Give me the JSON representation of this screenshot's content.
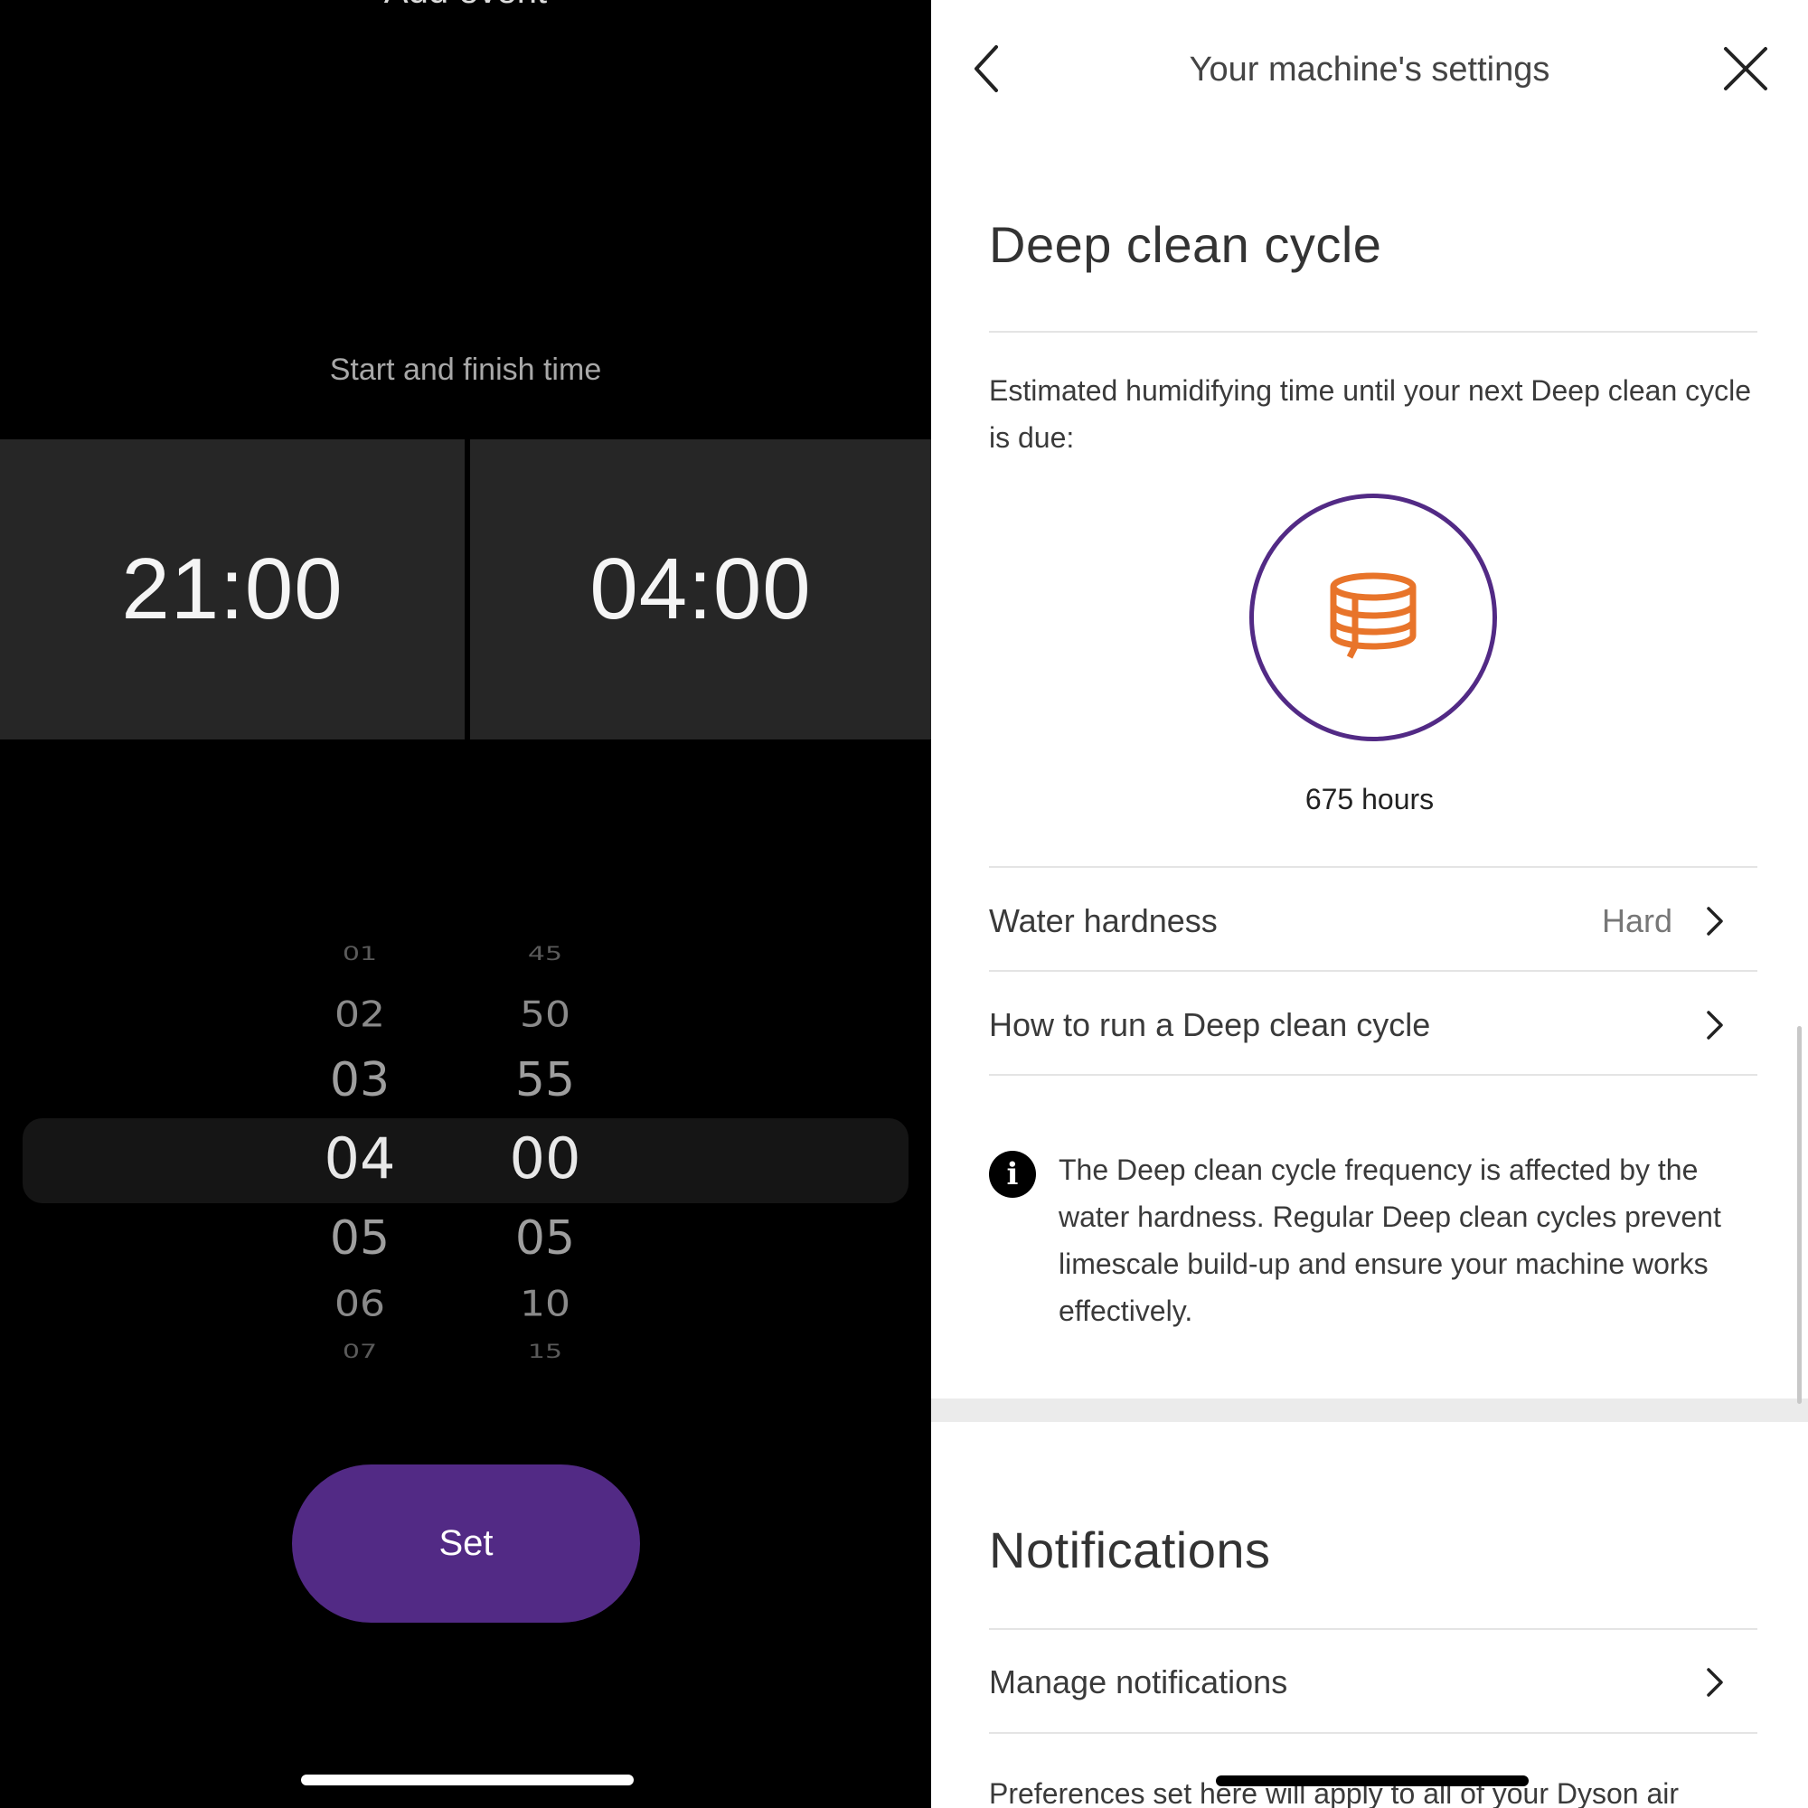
{
  "left_panel": {
    "header_title": "Add event",
    "subtitle": "Start and finish time",
    "start_time": "21:00",
    "finish_time": "04:00",
    "picker": {
      "hours": [
        "01",
        "02",
        "03",
        "04",
        "05",
        "06",
        "07"
      ],
      "minutes": [
        "45",
        "50",
        "55",
        "00",
        "05",
        "10",
        "15"
      ],
      "selected_hour": "04",
      "selected_minute": "00"
    },
    "set_button": "Set",
    "accent_color": "#522a85"
  },
  "right_panel": {
    "header_title": "Your machine's settings",
    "deep_clean": {
      "title": "Deep clean cycle",
      "estimate_text": "Estimated humidifying time until your next Deep clean cycle is due:",
      "hours": "675 hours",
      "icon": "filter-cartridge-icon",
      "icon_color": "#e8742a",
      "ring_color": "#522a85"
    },
    "rows": {
      "water_hardness_label": "Water hardness",
      "water_hardness_value": "Hard",
      "how_to_label": "How to run a Deep clean cycle"
    },
    "info_text": "The Deep clean cycle frequency is affected by the water hardness. Regular Deep clean cycles prevent limescale build-up and ensure your machine works effectively.",
    "notifications": {
      "title": "Notifications",
      "manage_label": "Manage notifications",
      "footer_text": "Preferences set here will apply to all of your Dyson air"
    }
  }
}
